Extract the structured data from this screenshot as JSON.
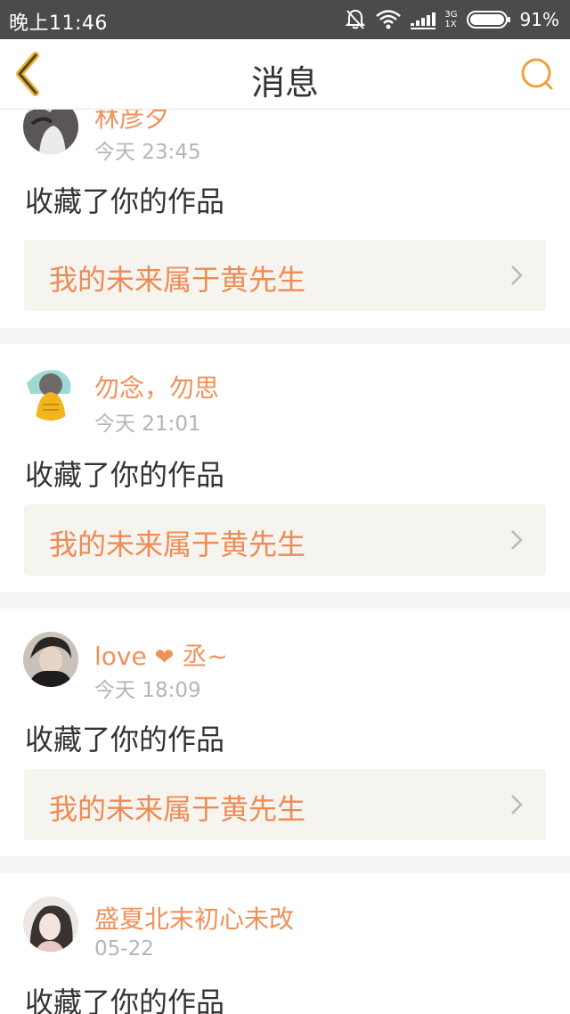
{
  "status_bar": {
    "time": "晚上11:46",
    "network_top": "3G",
    "network_bottom": "1X",
    "battery": "91%",
    "icons": [
      "bell-off-icon",
      "wifi-icon",
      "signal-icon",
      "battery-icon"
    ]
  },
  "header": {
    "title": "消息",
    "back_icon": "chevron-left-icon",
    "search_icon": "search-icon",
    "accent_color": "#f0a040"
  },
  "messages": [
    {
      "user": "林彦夕",
      "time": "今天 23:45",
      "action": "收藏了你的作品",
      "work_title": "我的未来属于黄先生"
    },
    {
      "user": "勿念，勿思",
      "time": "今天 21:01",
      "action": "收藏了你的作品",
      "work_title": "我的未来属于黄先生"
    },
    {
      "user_prefix": "love",
      "user_heart": "❤",
      "user_suffix": "丞~",
      "time": "今天 18:09",
      "action": "收藏了你的作品",
      "work_title": "我的未来属于黄先生"
    },
    {
      "user": "盛夏北末初心未改",
      "time": "05-22",
      "action": "收藏了你的作品"
    }
  ],
  "colors": {
    "username": "#f0915a",
    "work_title": "#ee8b55",
    "link_bg": "#f5f4ef",
    "divider": "#f5f5f5"
  }
}
